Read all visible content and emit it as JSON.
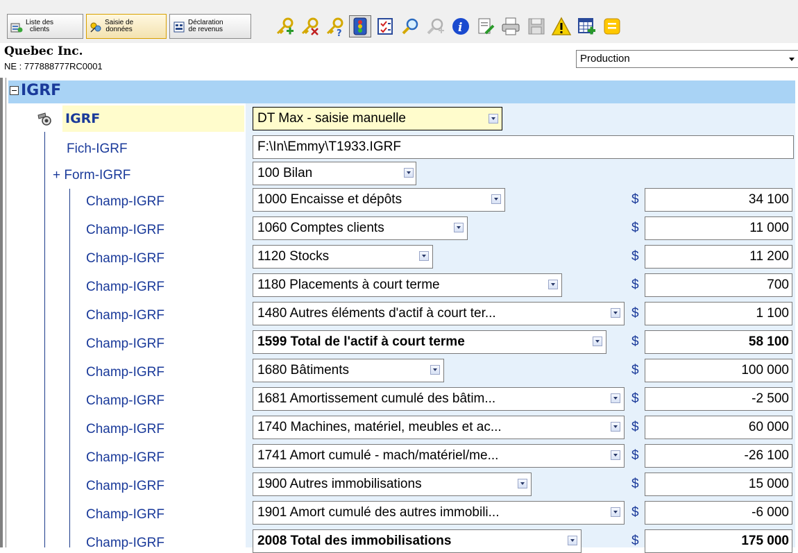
{
  "toolbar": {
    "tabs": [
      {
        "label": "Liste des\nclients",
        "icon": "client-list-icon"
      },
      {
        "label": "Saisie de\ndonnées",
        "icon": "data-entry-icon"
      },
      {
        "label": "Déclaration\nde revenus",
        "icon": "tax-return-icon"
      }
    ],
    "buttons": [
      "add-key-icon",
      "key-icon",
      "key-question-icon",
      "traffic-light-icon",
      "checklist-icon",
      "zoom-icon",
      "zoom-disabled-icon",
      "info-icon",
      "edit-document-icon",
      "print-icon",
      "save-icon",
      "warning-icon",
      "add-table-icon",
      "yellow-note-icon"
    ],
    "accent": "#1a3a9a"
  },
  "client": {
    "name": "Quebec Inc.",
    "ne": "NE : 777888777RC0001"
  },
  "environment": {
    "selected": "Production"
  },
  "section": {
    "title": "IGRF"
  },
  "igrf": {
    "label": "IGRF",
    "value": "DT Max - saisie manuelle",
    "fich_label": "Fich-IGRF",
    "fich_value": "F:\\In\\Emmy\\T1933.IGRF",
    "form_label": "+ Form-IGRF",
    "form_value": "100  Bilan"
  },
  "rows": [
    {
      "label": "Champ-IGRF",
      "field": "1000  Encaisse et dépôts",
      "currency": "$",
      "amount": "34 100",
      "bold": false
    },
    {
      "label": "Champ-IGRF",
      "field": "1060  Comptes clients",
      "currency": "$",
      "amount": "11 000",
      "bold": false
    },
    {
      "label": "Champ-IGRF",
      "field": "1120  Stocks",
      "currency": "$",
      "amount": "11 200",
      "bold": false
    },
    {
      "label": "Champ-IGRF",
      "field": "1180  Placements à court terme",
      "currency": "$",
      "amount": "700",
      "bold": false
    },
    {
      "label": "Champ-IGRF",
      "field": "1480  Autres éléments d'actif à court ter...",
      "currency": "$",
      "amount": "1 100",
      "bold": false
    },
    {
      "label": "Champ-IGRF",
      "field": "1599  Total de l'actif à court terme",
      "currency": "$",
      "amount": "58 100",
      "bold": true
    },
    {
      "label": "Champ-IGRF",
      "field": "1680  Bâtiments",
      "currency": "$",
      "amount": "100 000",
      "bold": false
    },
    {
      "label": "Champ-IGRF",
      "field": "1681  Amortissement cumulé des bâtim...",
      "currency": "$",
      "amount": "-2 500",
      "bold": false
    },
    {
      "label": "Champ-IGRF",
      "field": "1740  Machines, matériel, meubles et ac...",
      "currency": "$",
      "amount": "60 000",
      "bold": false
    },
    {
      "label": "Champ-IGRF",
      "field": "1741  Amort cumulé - mach/matériel/me...",
      "currency": "$",
      "amount": "-26 100",
      "bold": false
    },
    {
      "label": "Champ-IGRF",
      "field": "1900  Autres immobilisations",
      "currency": "$",
      "amount": "15 000",
      "bold": false
    },
    {
      "label": "Champ-IGRF",
      "field": "1901  Amort cumulé des autres immobili...",
      "currency": "$",
      "amount": "-6 000",
      "bold": false
    },
    {
      "label": "Champ-IGRF",
      "field": "2008  Total des immobilisations",
      "currency": "$",
      "amount": "175 000",
      "bold": true
    }
  ]
}
